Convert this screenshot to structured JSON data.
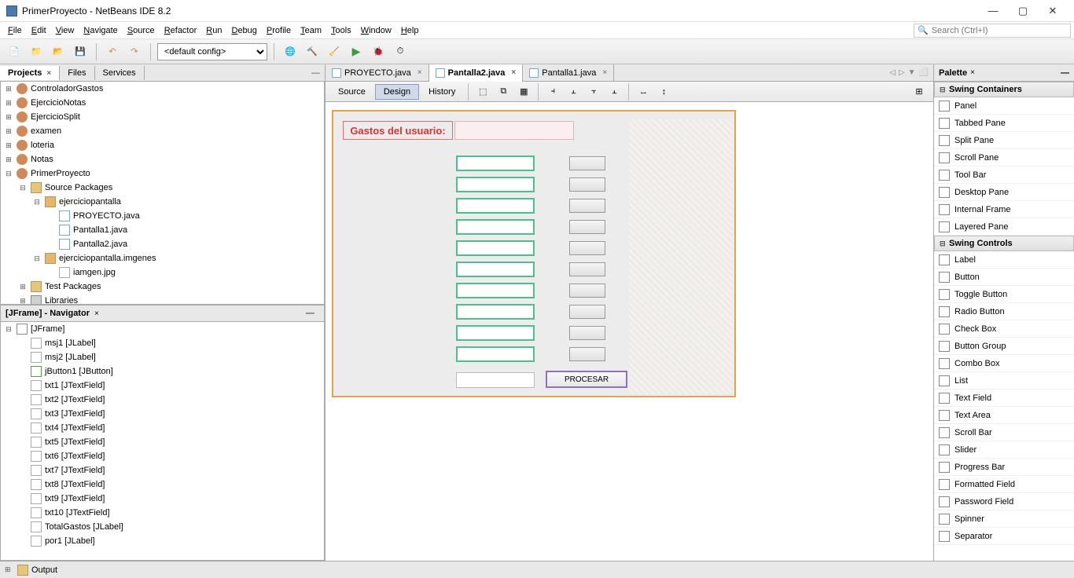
{
  "title": "PrimerProyecto - NetBeans IDE 8.2",
  "menus": [
    "File",
    "Edit",
    "View",
    "Navigate",
    "Source",
    "Refactor",
    "Run",
    "Debug",
    "Profile",
    "Team",
    "Tools",
    "Window",
    "Help"
  ],
  "search_placeholder": "Search (Ctrl+I)",
  "config": "<default config>",
  "left_tabs": {
    "projects": "Projects",
    "files": "Files",
    "services": "Services"
  },
  "project_tree": [
    {
      "d": 0,
      "tw": "⊞",
      "ic": "ic-coffee",
      "t": "ControladorGastos"
    },
    {
      "d": 0,
      "tw": "⊞",
      "ic": "ic-coffee",
      "t": "EjercicioNotas"
    },
    {
      "d": 0,
      "tw": "⊞",
      "ic": "ic-coffee",
      "t": "EjercicioSplit"
    },
    {
      "d": 0,
      "tw": "⊞",
      "ic": "ic-coffee",
      "t": "examen"
    },
    {
      "d": 0,
      "tw": "⊞",
      "ic": "ic-coffee",
      "t": "loteria"
    },
    {
      "d": 0,
      "tw": "⊞",
      "ic": "ic-coffee",
      "t": "Notas"
    },
    {
      "d": 0,
      "tw": "⊟",
      "ic": "ic-coffee",
      "t": "PrimerProyecto"
    },
    {
      "d": 1,
      "tw": "⊟",
      "ic": "ic-folder",
      "t": "Source Packages"
    },
    {
      "d": 2,
      "tw": "⊟",
      "ic": "ic-pkg",
      "t": "ejerciciopantalla"
    },
    {
      "d": 3,
      "tw": "",
      "ic": "ic-java",
      "t": "PROYECTO.java"
    },
    {
      "d": 3,
      "tw": "",
      "ic": "ic-java",
      "t": "Pantalla1.java"
    },
    {
      "d": 3,
      "tw": "",
      "ic": "ic-java",
      "t": "Pantalla2.java"
    },
    {
      "d": 2,
      "tw": "⊟",
      "ic": "ic-pkg",
      "t": "ejerciciopantalla.imgenes"
    },
    {
      "d": 3,
      "tw": "",
      "ic": "ic-img",
      "t": "iamgen.jpg"
    },
    {
      "d": 1,
      "tw": "⊞",
      "ic": "ic-folder",
      "t": "Test Packages"
    },
    {
      "d": 1,
      "tw": "⊞",
      "ic": "ic-lib",
      "t": "Libraries"
    }
  ],
  "navigator_title": "[JFrame] - Navigator",
  "navigator": [
    {
      "d": 0,
      "tw": "⊟",
      "ic": "ic-frame",
      "t": "[JFrame]"
    },
    {
      "d": 1,
      "tw": "",
      "ic": "ic-label",
      "t": "msj1 [JLabel]"
    },
    {
      "d": 1,
      "tw": "",
      "ic": "ic-label",
      "t": "msj2 [JLabel]"
    },
    {
      "d": 1,
      "tw": "",
      "ic": "ic-ok",
      "t": "jButton1 [JButton]"
    },
    {
      "d": 1,
      "tw": "",
      "ic": "ic-txt",
      "t": "txt1 [JTextField]"
    },
    {
      "d": 1,
      "tw": "",
      "ic": "ic-txt",
      "t": "txt2 [JTextField]"
    },
    {
      "d": 1,
      "tw": "",
      "ic": "ic-txt",
      "t": "txt3 [JTextField]"
    },
    {
      "d": 1,
      "tw": "",
      "ic": "ic-txt",
      "t": "txt4 [JTextField]"
    },
    {
      "d": 1,
      "tw": "",
      "ic": "ic-txt",
      "t": "txt5 [JTextField]"
    },
    {
      "d": 1,
      "tw": "",
      "ic": "ic-txt",
      "t": "txt6 [JTextField]"
    },
    {
      "d": 1,
      "tw": "",
      "ic": "ic-txt",
      "t": "txt7 [JTextField]"
    },
    {
      "d": 1,
      "tw": "",
      "ic": "ic-txt",
      "t": "txt8 [JTextField]"
    },
    {
      "d": 1,
      "tw": "",
      "ic": "ic-txt",
      "t": "txt9 [JTextField]"
    },
    {
      "d": 1,
      "tw": "",
      "ic": "ic-txt",
      "t": "txt10 [JTextField]"
    },
    {
      "d": 1,
      "tw": "",
      "ic": "ic-label",
      "t": "TotalGastos [JLabel]"
    },
    {
      "d": 1,
      "tw": "",
      "ic": "ic-label",
      "t": "por1 [JLabel]"
    }
  ],
  "editor_tabs": [
    {
      "name": "PROYECTO.java",
      "active": false
    },
    {
      "name": "Pantalla2.java",
      "active": true
    },
    {
      "name": "Pantalla1.java",
      "active": false
    }
  ],
  "views": {
    "source": "Source",
    "design": "Design",
    "history": "History"
  },
  "form": {
    "label": "Gastos del usuario:",
    "button": "PROCESAR"
  },
  "palette": {
    "title": "Palette",
    "sections": [
      {
        "name": "Swing Containers",
        "items": [
          "Panel",
          "Tabbed Pane",
          "Split Pane",
          "Scroll Pane",
          "Tool Bar",
          "Desktop Pane",
          "Internal Frame",
          "Layered Pane"
        ]
      },
      {
        "name": "Swing Controls",
        "items": [
          "Label",
          "Button",
          "Toggle Button",
          "Radio Button",
          "Check Box",
          "Button Group",
          "Combo Box",
          "List",
          "Text Field",
          "Text Area",
          "Scroll Bar",
          "Slider",
          "Progress Bar",
          "Formatted Field",
          "Password Field",
          "Spinner",
          "Separator"
        ]
      }
    ]
  },
  "output": "Output"
}
